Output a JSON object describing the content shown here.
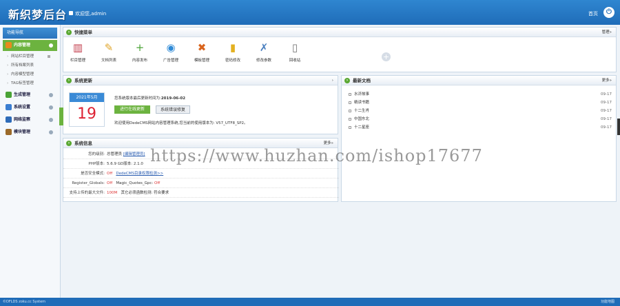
{
  "header": {
    "logo": "新织梦后台",
    "welcome": "欢迎您,admin",
    "home": "首页"
  },
  "sidebar": {
    "title": "功能导航",
    "groups": [
      {
        "label": "内容管理",
        "active": true,
        "color": "#e98a1d",
        "items": [
          "网站栏目管理",
          "所有档案列表",
          "内容模型管理",
          "TAG标签管理"
        ]
      },
      {
        "label": "生成管理",
        "color": "#4aa336"
      },
      {
        "label": "系统设置",
        "color": "#3b7ed1"
      },
      {
        "label": "网络监察",
        "color": "#2e6bb8"
      },
      {
        "label": "模块管理",
        "color": "#9b6a2a"
      }
    ]
  },
  "quick": {
    "title": "快捷菜单",
    "manage": "管理»",
    "items": [
      {
        "label": "栏目管理",
        "icon": "books-icon",
        "glyph": "▥",
        "color": "#c23b4a"
      },
      {
        "label": "文档列表",
        "icon": "notepad-icon",
        "glyph": "✎",
        "color": "#e0a52a"
      },
      {
        "label": "内容发布",
        "icon": "add-circle-icon",
        "glyph": "+",
        "color": "#4aa336"
      },
      {
        "label": "广告管理",
        "icon": "globe-icon",
        "glyph": "◉",
        "color": "#2f8ad6"
      },
      {
        "label": "模板管理",
        "icon": "tools-cross-icon",
        "glyph": "✖",
        "color": "#d9641d"
      },
      {
        "label": "密码修改",
        "icon": "lock-icon",
        "glyph": "▮",
        "color": "#e3b020"
      },
      {
        "label": "修改参数",
        "icon": "wrench-icon",
        "glyph": "✗",
        "color": "#4a7fbf"
      },
      {
        "label": "回收站",
        "icon": "trash-icon",
        "glyph": "▯",
        "color": "#777777"
      }
    ]
  },
  "update": {
    "title": "系统更新",
    "month": "2021年5月",
    "day": "19",
    "latest_label": "您系统版本最后更新时间为:",
    "latest_date": "2019-06-02",
    "btn_online": "进行在线更新",
    "btn_fix": "系统错误修复",
    "using_text": "欢迎使用DedeCMS网站内容管理系统,您当前的使用版本为: V57_UTF8_SP2。"
  },
  "news": {
    "title": "最新文档",
    "more": "更多»",
    "items": [
      {
        "title": "水浒故事",
        "date": "09-17"
      },
      {
        "title": "精读书籍",
        "date": "09-17"
      },
      {
        "title": "十二生肖",
        "date": "09-17"
      },
      {
        "title": "中国东北",
        "date": "09-17"
      },
      {
        "title": "十二星座",
        "date": "09-17"
      }
    ]
  },
  "sysinfo": {
    "title": "系统信息",
    "more": "更多»",
    "rows": [
      {
        "label": "您的级别:",
        "value": "总管理员",
        "extra": "[编辑管理员]"
      },
      {
        "label": "PHP版本:",
        "value": "5.6.9  GD版本: 2.1.0"
      },
      {
        "label": "是否安全模式:",
        "value": "Off",
        "extra": "DedeCMS目录权限检测>>"
      },
      {
        "label": "Register_Globals:",
        "value": "Off",
        "extra": "Magic_Quotes_Gpc:",
        "extra2": "Off"
      },
      {
        "label": "支持上传的最大文件:",
        "value": "100M",
        "extra": "其它必须函数检测: 符合要求"
      }
    ]
  },
  "footer": {
    "left": "©DFLDS  zoku.cc System",
    "right": "功能地图"
  },
  "watermark": "https://www.huzhan.com/ishop17677"
}
